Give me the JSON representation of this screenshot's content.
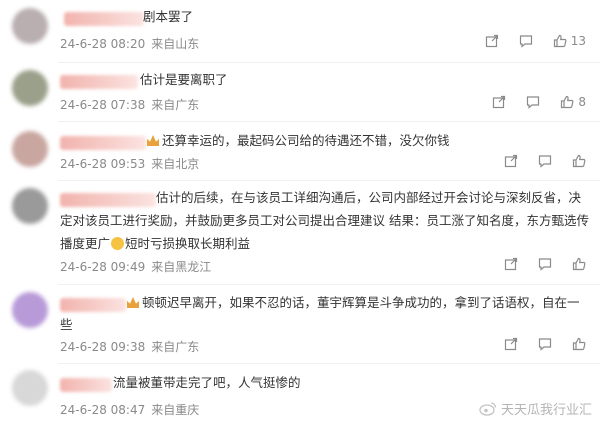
{
  "comments": [
    {
      "text_lines": [
        "剧本罢了"
      ],
      "meta": {
        "date": "24-6-28 08:20",
        "location": "来自山东"
      },
      "likes": "13",
      "avatar_color": "#b9aeb0"
    },
    {
      "text_lines": [
        "估计是要离职了"
      ],
      "meta": {
        "date": "24-6-28 07:38",
        "location": "来自广东"
      },
      "likes": "8",
      "avatar_color": "#9aa08a"
    },
    {
      "text_lines": [
        "还算幸运的，最起码公司给的待遇还不错，没欠你钱"
      ],
      "meta": {
        "date": "24-6-28 09:53",
        "location": "来自北京"
      },
      "likes": "",
      "avatar_color": "#c9a6a0"
    },
    {
      "text_lines": [
        "估计的后续，在与该员工详细沟通后，公司内部经过开会讨论与深刻反省，决",
        "定对该员工进行奖励，并鼓励更多员工对公司提出合理建议 结果：员工涨了知名度，东方甄选传",
        "播度更广",
        "短时亏损换取长期利益"
      ],
      "meta": {
        "date": "24-6-28 09:49",
        "location": "来自黑龙江"
      },
      "likes": "",
      "avatar_color": "#9a9a9a"
    },
    {
      "text_lines": [
        "顿顿迟早离开，如果不忍的话，董宇辉算是斗争成功的，拿到了话语权，自在一",
        "些"
      ],
      "meta": {
        "date": "24-6-28 09:38",
        "location": "来自广东"
      },
      "likes": "",
      "avatar_color": "#b89ad8"
    },
    {
      "text_lines": [
        "流量被董带走完了吧，人气挺惨的"
      ],
      "meta": {
        "date": "24-6-28 08:47",
        "location": "来自重庆"
      },
      "likes": "",
      "avatar_color": "#d8d8d8"
    }
  ],
  "watermark": {
    "text": "天天瓜我行业汇"
  }
}
